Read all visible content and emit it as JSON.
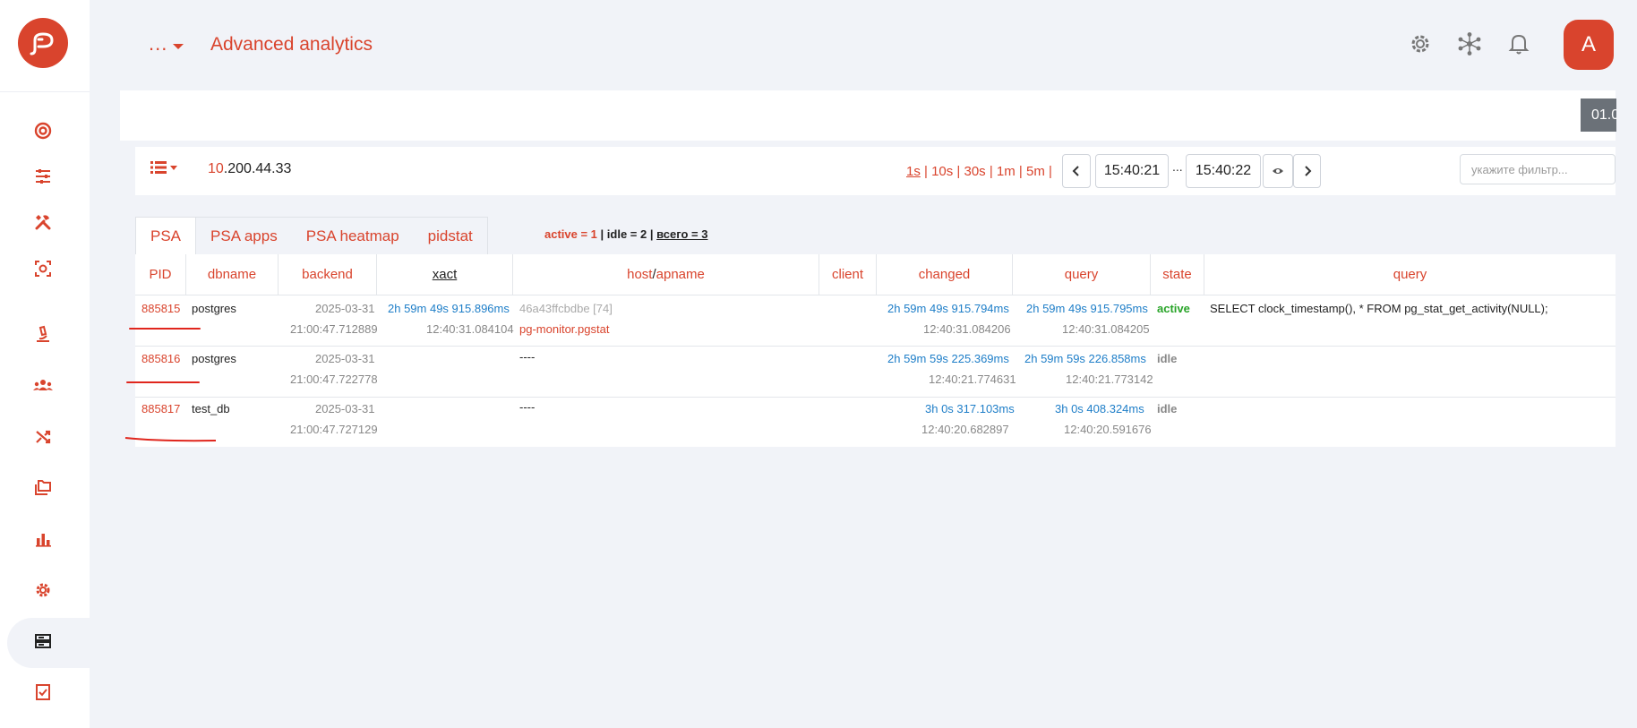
{
  "header": {
    "crumb": "...",
    "title": "Advanced analytics",
    "avatar_letter": "A",
    "icons": [
      "gear-icon",
      "network-icon",
      "bell-icon"
    ]
  },
  "sidebar": {
    "items": [
      {
        "icon": "target-icon"
      },
      {
        "icon": "sliders-icon"
      },
      {
        "icon": "tools-icon"
      },
      {
        "icon": "scan-icon"
      },
      {
        "icon": "microscope-icon"
      },
      {
        "icon": "users-icon"
      },
      {
        "icon": "shuffle-icon"
      },
      {
        "icon": "folders-icon"
      },
      {
        "icon": "bar-chart-icon"
      },
      {
        "icon": "cog-icon"
      },
      {
        "icon": "server-icon",
        "active": true
      },
      {
        "icon": "checklist-icon"
      }
    ]
  },
  "band": {
    "badge": "01.0"
  },
  "toolbar": {
    "ip_prefix": "10",
    "ip_rest": ".200.44.33",
    "intervals": [
      "1s",
      "10s",
      "30s",
      "1m",
      "5m"
    ],
    "time_from": "15:40:21",
    "time_range_sep": "...",
    "time_to": "15:40:22",
    "filter_placeholder": "укажите фильтр..."
  },
  "tabs": [
    "PSA",
    "PSA apps",
    "PSA heatmap",
    "pidstat"
  ],
  "counts": {
    "active": "active = 1",
    "sep1": " | ",
    "idle": "idle = 2",
    "sep2": " | ",
    "all": "всего = 3"
  },
  "table": {
    "columns": {
      "pid": "PID",
      "dbname": "dbname",
      "backend": "backend",
      "xact": "xact",
      "host": "host",
      "host_sep": " / ",
      "apname": "apname",
      "client": "client",
      "changed": "changed",
      "query_time": "query",
      "state": "state",
      "query": "query"
    },
    "rows": [
      {
        "pid": "885815",
        "dbname": "postgres",
        "backend_date": "2025-03-31",
        "backend_time": "21:00:47.712889",
        "xact_dur": "2h 59m 49s 915.896ms",
        "xact_time": "12:40:31.084104",
        "host": "46a43ffcbdbe [74]",
        "apname": "pg-monitor.pgstat",
        "changed_dur": "2h 59m 49s 915.794ms",
        "changed_time": "12:40:31.084206",
        "query_dur": "2h 59m 49s 915.795ms",
        "query_time": "12:40:31.084205",
        "state": "active",
        "query": "SELECT clock_timestamp(), * FROM pg_stat_get_activity(NULL);"
      },
      {
        "pid": "885816",
        "dbname": "postgres",
        "backend_date": "2025-03-31",
        "backend_time": "21:00:47.722778",
        "host": "----",
        "changed_dur": "2h 59m 59s 225.369ms",
        "changed_time": "12:40:21.774631",
        "query_dur": "2h 59m 59s 226.858ms",
        "query_time": "12:40:21.773142",
        "state": "idle"
      },
      {
        "pid": "885817",
        "dbname": "test_db",
        "backend_date": "2025-03-31",
        "backend_time": "21:00:47.727129",
        "host": "----",
        "changed_dur": "3h 0s 317.103ms",
        "changed_time": "12:40:20.682897",
        "query_dur": "3h 0s 408.324ms",
        "query_time": "12:40:20.591676",
        "state": "idle"
      }
    ]
  },
  "colors": {
    "accent": "#d9442d",
    "blue": "#1e7ec8",
    "active": "#28a428",
    "grey": "#888888"
  }
}
